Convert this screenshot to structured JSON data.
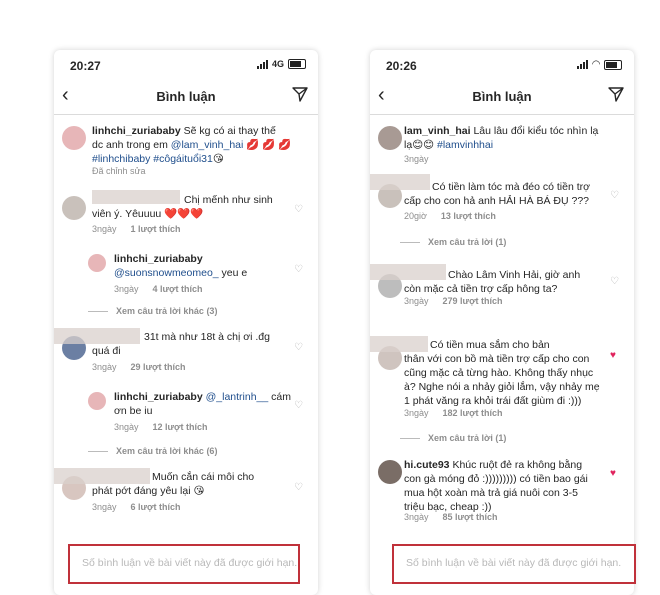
{
  "left": {
    "status": {
      "time": "20:27",
      "network": "4G"
    },
    "nav": {
      "title": "Bình luận"
    },
    "caption": {
      "user": "linhchi_zuriababy",
      "text1": " Sẽ kg có ai thay thế",
      "text2": "dc anh trong em ",
      "mention": "@lam_vinh_hai",
      "hearts": " 💋 💋 💋",
      "tags": "#linhchibaby #côgáituổi31",
      "emoji": "😘",
      "meta": "Đã chỉnh sửa"
    },
    "c1": {
      "text1": "Chị mếnh như sinh",
      "text2": "viên ý. Yêuuuu ",
      "hearts": "❤️❤️❤️",
      "time": "3ngày",
      "likes": "1 lượt thích"
    },
    "r1": {
      "user": "linhchi_zuriababy",
      "mention": "@suonsnowmeomeo_",
      "text": " yeu e",
      "time": "3ngày",
      "likes": "4 lượt thích"
    },
    "more1": "Xem câu trả lời khác (3)",
    "c2": {
      "text1": "31t mà như 18t à chị ơi .đg",
      "text2": "quá đi",
      "time": "3ngày",
      "likes": "29 lượt thích"
    },
    "r2": {
      "user": "linhchi_zuriababy",
      "mention": "@_lantrinh__",
      "text": " cám",
      "text2": "ơn be iu",
      "time": "3ngày",
      "likes": "12 lượt thích"
    },
    "more2": "Xem câu trả lời khác (6)",
    "c3": {
      "text1": "Muốn cắn cái môi cho",
      "text2": "phát  pớt đáng yêu lại ",
      "emoji": "😘",
      "time": "3ngày",
      "likes": "6 lượt thích"
    },
    "limit": "Số bình luận về bài viết này đã được giới hạn."
  },
  "right": {
    "status": {
      "time": "20:26"
    },
    "nav": {
      "title": "Bình luận"
    },
    "caption": {
      "user": "lam_vinh_hai",
      "text1": " Lâu lâu đổi kiểu tóc nhìn lạ",
      "text2": "lạ",
      "emoji": "😊😊",
      "tags": " #lamvinhhai",
      "meta": "3ngày"
    },
    "c1": {
      "text1": "Có tiền làm tóc mà đéo có tiền trợ",
      "text2": "cấp cho con hả anh HẢI HÀ BÁ ĐỤ ???",
      "time": "20giờ",
      "likes": "13 lượt thích"
    },
    "more1": "Xem câu trả lời (1)",
    "c2": {
      "text1": "Chào Lâm Vinh Hải, giờ anh",
      "text2": "còn mặc cả tiền trợ cấp hông ta?",
      "time": "3ngày",
      "likes": "279 lượt thích"
    },
    "c3": {
      "text1": "Có tiền mua sắm cho bản",
      "text2": "thân với con bồ mà tiền trợ cấp cho con",
      "text3": "cũng mặc cả từng hào. Không thấy nhục",
      "text4": "à? Nghe nói a nhảy giỏi lắm, vậy nhảy mẹ",
      "text5": "1 phát văng ra khỏi trái đất giùm đi :)))",
      "time": "3ngày",
      "likes": "182 lượt thích"
    },
    "more2": "Xem câu trả lời (1)",
    "c4": {
      "user": "hi.cute93",
      "text1": " Khúc ruột đẻ ra không bằng",
      "text2": "con gà móng đỏ :))))))))) có tiền bao gái",
      "text3": "mua hột xoàn mà trả giá nuôi con 3-5",
      "text4": "triệu bạc, cheap :))",
      "time": "3ngày",
      "likes": "85 lượt thích"
    },
    "limit": "Số bình luận về bài viết này đã được giới hạn."
  }
}
